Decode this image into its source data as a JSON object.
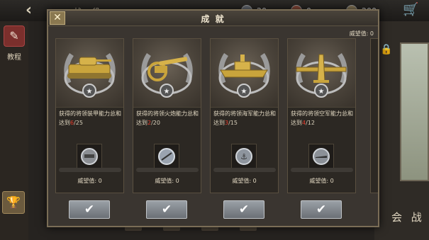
{
  "background": {
    "title": "战 役",
    "resources": [
      {
        "icon": "medal-resource-icon",
        "value": "20"
      },
      {
        "icon": "badge-resource-icon",
        "value": "0"
      },
      {
        "icon": "crest-resource-icon",
        "value": "200"
      }
    ],
    "side_tutorial_label": "教程",
    "battle_label": "会 战"
  },
  "dialog": {
    "title": "成 就",
    "close_label": "✕",
    "prestige_total": "威望值: 0",
    "cards": [
      {
        "art_icon": "tank-icon",
        "desc": "获得的将领装甲能力总和达到",
        "current": "6",
        "target": "/25",
        "prestige": "威望值: 0",
        "medal_icon": "armor-medal-icon"
      },
      {
        "art_icon": "artillery-icon",
        "desc": "获得的将领火炮能力总和达到",
        "current": "2",
        "target": "/20",
        "prestige": "威望值: 0",
        "medal_icon": "artillery-medal-icon"
      },
      {
        "art_icon": "warship-icon",
        "desc": "获得的将领海军能力总和达到",
        "current": "3",
        "target": "/15",
        "prestige": "威望值: 0",
        "medal_icon": "navy-medal-icon"
      },
      {
        "art_icon": "fighter-plane-icon",
        "desc": "获得的将领空军能力总和达到",
        "current": "4",
        "target": "/12",
        "prestige": "威望值: 0",
        "medal_icon": "airforce-medal-icon"
      }
    ],
    "claim_label": "✔"
  },
  "colors": {
    "progress_current": "#e03a2a",
    "dialog_bg": "#3a3530",
    "button": "#8a8f95"
  }
}
